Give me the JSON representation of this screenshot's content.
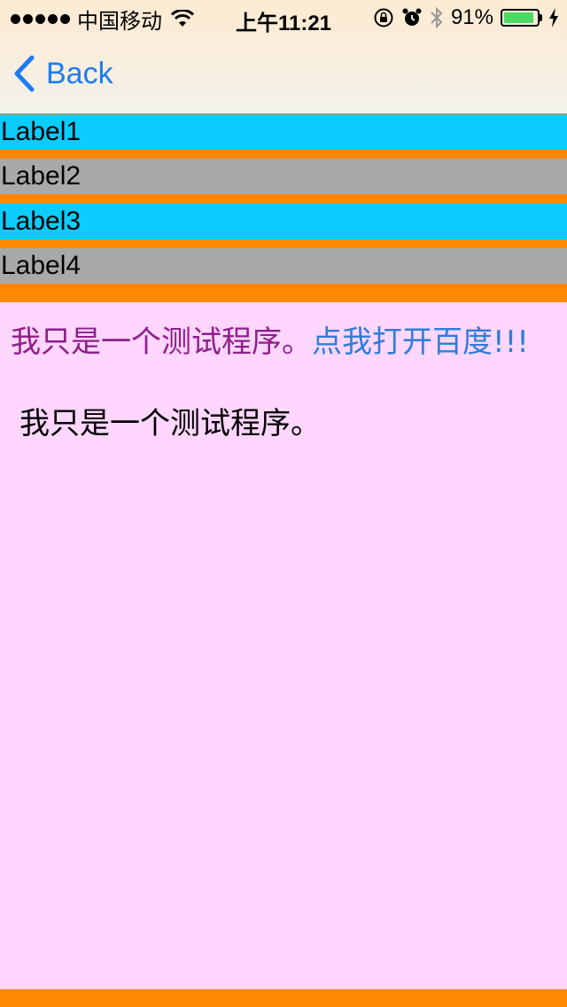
{
  "status_bar": {
    "carrier": "中国移动",
    "time": "上午11:21",
    "battery_percent": "91%",
    "battery_level": 0.91,
    "icons": [
      "signal-dots-icon",
      "wifi-icon",
      "orientation-lock-icon",
      "alarm-icon",
      "bluetooth-icon",
      "battery-icon",
      "charging-bolt-icon"
    ]
  },
  "nav": {
    "back_label": "Back",
    "back_icon": "chevron-left-icon",
    "tint": "#1E7CF2"
  },
  "labels": [
    {
      "text": "Label1",
      "color": "#0CCBFD"
    },
    {
      "text": "Label2",
      "color": "#A9A9A9"
    },
    {
      "text": "Label3",
      "color": "#0CCBFD"
    },
    {
      "text": "Label4",
      "color": "#A9A9A9"
    }
  ],
  "content": {
    "rich_text_plain": "我只是一个测试程序。",
    "rich_text_link": "点我打开百度!!!",
    "plain_text": "我只是一个测试程序。",
    "background": "#FFD6FF",
    "purple": "#8E1E8C",
    "link_color": "#2E7DDA"
  },
  "page_background": "#FF8800"
}
